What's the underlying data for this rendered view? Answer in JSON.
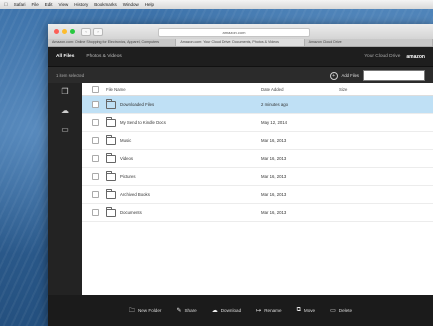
{
  "menubar": {
    "items": [
      "Safari",
      "File",
      "Edit",
      "View",
      "History",
      "Bookmarks",
      "Window",
      "Help"
    ]
  },
  "browser": {
    "url": "amazon.com",
    "tabs": [
      "Amazon.com: Online Shopping for Electronics, Apparel, Computers",
      "Amazon.com: Your Cloud Drive: Documents, Photos & Videos",
      "Amazon Cloud Drive"
    ]
  },
  "app": {
    "nav": {
      "all_files": "All Files",
      "photos_videos": "Photos & Videos"
    },
    "header_right": {
      "account": "Your Cloud Drive",
      "brand": "amazon"
    },
    "toolbar": {
      "selection": "1 item selected",
      "add_files": "Add Files",
      "search_placeholder": ""
    }
  },
  "table": {
    "columns": {
      "name": "File Name",
      "date": "Date Added",
      "size": "Size"
    },
    "rows": [
      {
        "name": "Downloaded Files",
        "date": "2 minutes ago",
        "size": ""
      },
      {
        "name": "My Send to Kindle Docs",
        "date": "May 12, 2014",
        "size": ""
      },
      {
        "name": "Music",
        "date": "Mar 16, 2013",
        "size": ""
      },
      {
        "name": "Videos",
        "date": "Mar 16, 2013",
        "size": ""
      },
      {
        "name": "Pictures",
        "date": "Mar 16, 2013",
        "size": ""
      },
      {
        "name": "Archived Books",
        "date": "Mar 16, 2013",
        "size": ""
      },
      {
        "name": "Documents",
        "date": "Mar 16, 2013",
        "size": ""
      }
    ]
  },
  "actions": {
    "new_folder": "New Folder",
    "share": "Share",
    "download": "Download",
    "rename": "Rename",
    "move": "Move",
    "delete": "Delete"
  },
  "colors": {
    "selected_row": "#bfe0f5",
    "dark_chrome": "#1e1e1e",
    "close": "#fc5f57",
    "minimize": "#fdbc2e",
    "zoom": "#28c840"
  }
}
